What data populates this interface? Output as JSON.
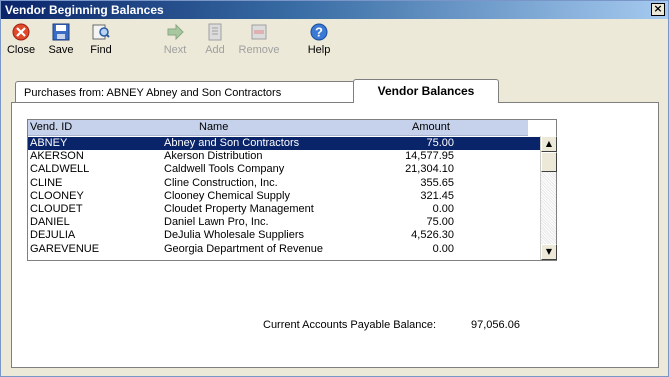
{
  "window": {
    "title": "Vendor Beginning Balances"
  },
  "toolbar": {
    "buttons": [
      {
        "label": "Close",
        "icon": "close-icon",
        "enabled": true
      },
      {
        "label": "Save",
        "icon": "save-icon",
        "enabled": true
      },
      {
        "label": "Find",
        "icon": "find-icon",
        "enabled": true
      },
      {
        "label": "Next",
        "icon": "next-icon",
        "enabled": false
      },
      {
        "label": "Add",
        "icon": "add-icon",
        "enabled": false
      },
      {
        "label": "Remove",
        "icon": "remove-icon",
        "enabled": false
      },
      {
        "label": "Help",
        "icon": "help-icon",
        "enabled": true
      }
    ]
  },
  "tabs": {
    "purchases": "Purchases from: ABNEY Abney and Son Contractors",
    "vendor_balances": "Vendor Balances"
  },
  "grid": {
    "headers": {
      "vend_id": "Vend. ID",
      "name": "Name",
      "amount": "Amount"
    },
    "rows": [
      {
        "vend_id": "ABNEY",
        "name": "Abney and Son Contractors",
        "amount": "75.00"
      },
      {
        "vend_id": "AKERSON",
        "name": "Akerson Distribution",
        "amount": "14,577.95"
      },
      {
        "vend_id": "CALDWELL",
        "name": "Caldwell Tools Company",
        "amount": "21,304.10"
      },
      {
        "vend_id": "CLINE",
        "name": "Cline Construction, Inc.",
        "amount": "355.65"
      },
      {
        "vend_id": "CLOONEY",
        "name": "Clooney Chemical Supply",
        "amount": "321.45"
      },
      {
        "vend_id": "CLOUDET",
        "name": "Cloudet Property Management",
        "amount": "0.00"
      },
      {
        "vend_id": "DANIEL",
        "name": "Daniel Lawn Pro, Inc.",
        "amount": "75.00"
      },
      {
        "vend_id": "DEJULIA",
        "name": "DeJulia Wholesale Suppliers",
        "amount": "4,526.30"
      },
      {
        "vend_id": "GAREVENUE",
        "name": "Georgia Department of Revenue",
        "amount": "0.00"
      }
    ],
    "selected_index": 0
  },
  "summary": {
    "label": "Current Accounts Payable Balance:",
    "value": "97,056.06"
  },
  "colors": {
    "selection": "#0a246a",
    "titlebar_start": "#0a246a",
    "header_bg": "#c6d2ec"
  }
}
